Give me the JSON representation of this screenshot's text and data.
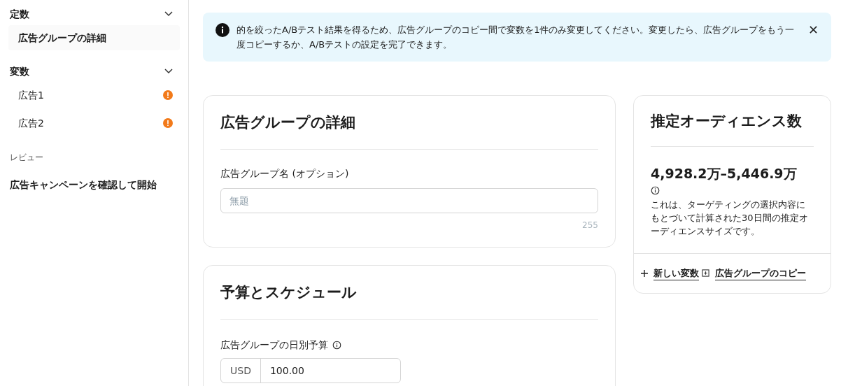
{
  "sidebar": {
    "sections": [
      {
        "title": "定数",
        "expanded": true,
        "items": [
          {
            "label": "広告グループの詳細",
            "selected": true,
            "warning": false
          }
        ]
      },
      {
        "title": "変数",
        "expanded": true,
        "items": [
          {
            "label": "広告1",
            "selected": false,
            "warning": true
          },
          {
            "label": "広告2",
            "selected": false,
            "warning": true
          }
        ]
      }
    ],
    "review_heading": "レビュー",
    "review_item": "広告キャンペーンを確認して開始"
  },
  "banner": {
    "text": "的を絞ったA/Bテスト結果を得るため、広告グループのコピー間で変数を1件のみ変更してください。変更したら、広告グループをもう一度コピーするか、A/Bテストの設定を完了できます。"
  },
  "details_card": {
    "title": "広告グループの詳細",
    "name_label": "広告グループ名 (オプション)",
    "name_placeholder": "無題",
    "char_limit": "255"
  },
  "budget_card": {
    "title": "予算とスケジュール",
    "budget_label": "広告グループの日別予算",
    "currency": "USD",
    "budget_value": "100.00"
  },
  "audience_card": {
    "title": "推定オーディエンス数",
    "range": "4,928.2万–5,446.9万",
    "description": "これは、ターゲティングの選択内容にもとづいて計算された30日間の推定オーディエンスサイズです。",
    "new_variable_link": "新しい変数",
    "copy_link": "広告グループのコピー"
  }
}
